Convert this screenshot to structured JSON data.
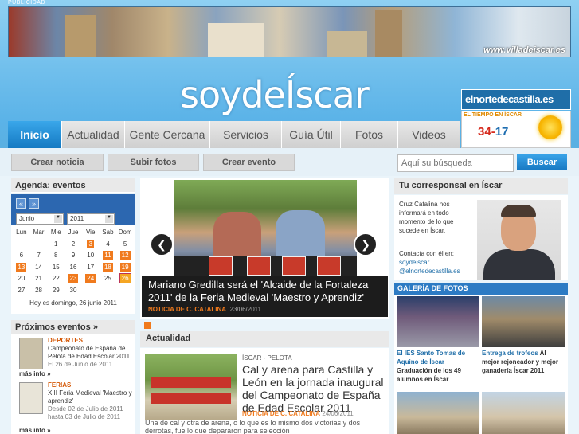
{
  "publicidad": "PUBLICIDAD",
  "banner": {
    "url": "www.villadeiscar.es"
  },
  "logo": {
    "prefix": "soy",
    "brand": "de",
    "suffix": "Íscar"
  },
  "partner": {
    "name": "elnortedecastilla.es"
  },
  "weather": {
    "title": "EL TIEMPO EN ÍSCAR",
    "max": "34",
    "sep": "-",
    "min": "17"
  },
  "nav": {
    "tabs": [
      {
        "label": "Inicio",
        "active": true
      },
      {
        "label": "Actualidad"
      },
      {
        "label": "Gente Cercana"
      },
      {
        "label": "Servicios"
      },
      {
        "label": "Guía Útil"
      },
      {
        "label": "Fotos"
      },
      {
        "label": "Videos"
      }
    ]
  },
  "subnav": {
    "buttons": [
      "Crear noticia",
      "Subir fotos",
      "Crear evento"
    ],
    "search_placeholder": "Aquí su búsqueda",
    "search_button": "Buscar"
  },
  "agenda": {
    "title": "Agenda: eventos",
    "month": "Junio",
    "year": "2011",
    "prev": "«",
    "next": "»",
    "weekdays": [
      "Lun",
      "Mar",
      "Mie",
      "Jue",
      "Vie",
      "Sab",
      "Dom"
    ],
    "weeks": [
      [
        "",
        "",
        "1",
        "2",
        "3",
        "4",
        "5"
      ],
      [
        "6",
        "7",
        "8",
        "9",
        "10",
        "11",
        "12"
      ],
      [
        "13",
        "14",
        "15",
        "16",
        "17",
        "18",
        "19"
      ],
      [
        "20",
        "21",
        "22",
        "23",
        "24",
        "25",
        "26"
      ],
      [
        "27",
        "28",
        "29",
        "30",
        "",
        "",
        ""
      ]
    ],
    "event_days": [
      "3",
      "11",
      "12",
      "13",
      "18",
      "19",
      "23",
      "24",
      "26"
    ],
    "today": "26",
    "today_text": "Hoy es domingo, 26 junio 2011"
  },
  "proximos": {
    "title": "Próximos eventos »",
    "events": [
      {
        "category": "DEPORTES",
        "title": "Campeonato de España de Pelota de Edad Escolar 2011",
        "date": "El 26 de Junio de 2011",
        "more": "más info »"
      },
      {
        "category": "FERIAS",
        "title": "XIII Feria Medieval 'Maestro y aprendiz'",
        "date": "Desde 02 de Julio de 2011 hasta 03 de Julio de 2011",
        "more": "más info »"
      }
    ]
  },
  "slider": {
    "title": "Mariano Gredilla será el 'Alcaide de la Fortaleza 2011' de la Feria Medieval 'Maestro y Aprendiz'",
    "author": "NOTICIA DE C. CATALINA",
    "date": "23/06/2011",
    "prev": "❮",
    "next": "❯"
  },
  "actualidad": {
    "title": "Actualidad",
    "kicker": "ÍSCAR - PELOTA",
    "headline": "Cal y arena para Castilla y León en la jornada inaugural del Campeonato de España de Edad Escolar 2011",
    "author": "NOTICIA DE C. CATALINA",
    "date": "24/06/2011",
    "text": "Una de cal y otra de arena, o lo que es lo mismo dos victorias y dos derrotas, fue lo que depararon para selección"
  },
  "corresponsal": {
    "title": "Tu corresponsal en Íscar",
    "text": "Cruz Catalina nos informará en todo momento de lo que sucede en Íscar.",
    "contact_label": "Contacta con él en:",
    "link1": "soydeiscar",
    "link2": "@elnortedecastilla.es"
  },
  "galeria": {
    "title": "GALERÍA DE FOTOS",
    "items": [
      {
        "link": "El IES Santo Tomas de Aquino de Íscar",
        "text": "Graduación de los 49 alumnos en Íscar"
      },
      {
        "link": "Entrega de trofeos",
        "text": "Al mejor rejoneador y mejor ganadería Íscar 2011"
      }
    ]
  }
}
